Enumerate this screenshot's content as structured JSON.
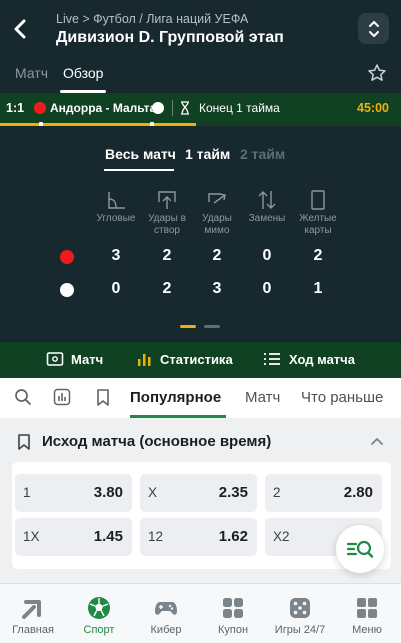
{
  "header": {
    "breadcrumb": "Live > Футбол / Лига наций УЕФА",
    "title": "Дивизион D. Групповой этап"
  },
  "tabs": [
    {
      "label": "Матч",
      "active": false
    },
    {
      "label": "Обзор",
      "active": true
    }
  ],
  "scoreboard": {
    "score": "1:1",
    "teams": "Андорра - Мальта",
    "status": "Конец 1 тайма",
    "time": "45:00",
    "team1_color": "#ef1b1b",
    "team2_color": "#ffffff",
    "progress": 0.49
  },
  "stats": {
    "periods": [
      {
        "label": "Весь матч",
        "active": true
      },
      {
        "label": "1 тайм",
        "active": false
      },
      {
        "label": "2 тайм",
        "active": false,
        "disabled": true
      }
    ],
    "columns": [
      {
        "icon": "corner-flag-icon",
        "label": "Угловые"
      },
      {
        "icon": "shot-on-target-icon",
        "label": "Удары в створ"
      },
      {
        "icon": "shot-off-target-icon",
        "label": "Удары мимо"
      },
      {
        "icon": "substitution-icon",
        "label": "Замены"
      },
      {
        "icon": "yellow-card-icon",
        "label": "Желтые карты"
      }
    ],
    "rows": [
      {
        "team_color": "#ef1b1b",
        "values": [
          "3",
          "2",
          "2",
          "0",
          "2"
        ]
      },
      {
        "team_color": "#ffffff",
        "values": [
          "0",
          "2",
          "3",
          "0",
          "1"
        ]
      }
    ],
    "page_indicator": {
      "pages": 2,
      "current": 1
    }
  },
  "subnav": [
    {
      "icon": "field-icon",
      "label": "Матч",
      "active": false
    },
    {
      "icon": "bar-chart-icon",
      "label": "Статистика",
      "active": true
    },
    {
      "icon": "list-icon",
      "label": "Ход матча",
      "active": false
    }
  ],
  "filterbar": {
    "tabs": [
      {
        "label": "Популярное",
        "active": true
      },
      {
        "label": "Матч",
        "active": false
      },
      {
        "label": "Что раньше",
        "active": false
      }
    ]
  },
  "market": {
    "title": "Исход матча (основное время)",
    "odds": [
      {
        "label": "1",
        "value": "3.80"
      },
      {
        "label": "X",
        "value": "2.35"
      },
      {
        "label": "2",
        "value": "2.80"
      },
      {
        "label": "1X",
        "value": "1.45"
      },
      {
        "label": "12",
        "value": "1.62"
      },
      {
        "label": "X2",
        "value": ""
      }
    ]
  },
  "bottomnav": [
    {
      "icon": "home-icon",
      "label": "Главная",
      "active": false
    },
    {
      "icon": "soccer-ball-icon",
      "label": "Спорт",
      "active": true
    },
    {
      "icon": "gamepad-icon",
      "label": "Кибер",
      "active": false
    },
    {
      "icon": "coupon-icon",
      "label": "Купон",
      "active": false
    },
    {
      "icon": "dice-icon",
      "label": "Игры 24/7",
      "active": false
    },
    {
      "icon": "menu-grid-icon",
      "label": "Меню",
      "active": false
    }
  ],
  "colors": {
    "header_bg": "#17282f",
    "green_bar": "#114123",
    "accent_green": "#1f8a45",
    "accent_yellow": "#f0b000"
  }
}
